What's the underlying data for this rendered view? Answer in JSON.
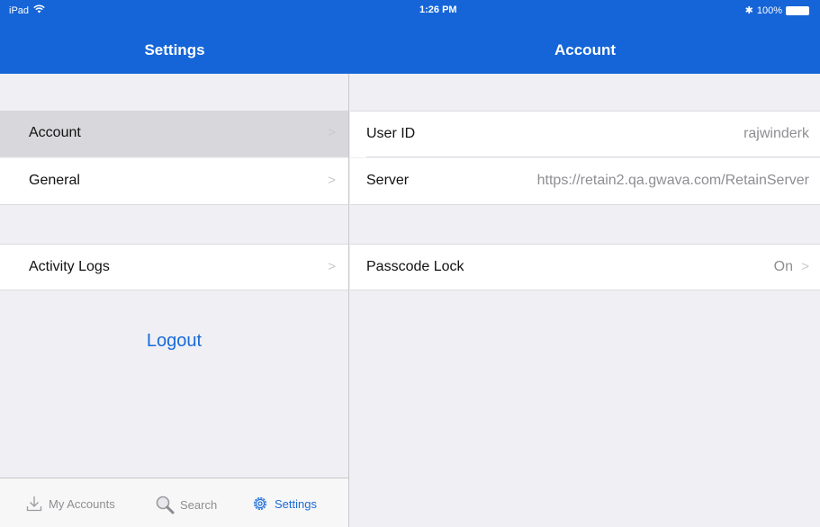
{
  "status_bar": {
    "device": "iPad",
    "time": "1:26 PM",
    "battery": "100%"
  },
  "master": {
    "title": "Settings",
    "items": [
      {
        "label": "Account",
        "selected": true
      },
      {
        "label": "General"
      },
      {
        "label": "Activity Logs"
      }
    ],
    "logout_label": "Logout"
  },
  "detail": {
    "title": "Account",
    "user_id_label": "User ID",
    "user_id_value": "rajwinderk",
    "server_label": "Server",
    "server_value": "https://retain2.qa.gwava.com/RetainServer",
    "passcode_label": "Passcode Lock",
    "passcode_value": "On"
  },
  "tab_bar": {
    "items": [
      {
        "label": "My Accounts",
        "icon": "download-icon"
      },
      {
        "label": "Search",
        "icon": "magnifier-icon"
      },
      {
        "label": "Settings",
        "icon": "gear-icon",
        "active": true
      }
    ]
  },
  "colors": {
    "header": "#1565d8",
    "accent": "#1a6ad8",
    "background": "#efeff4"
  }
}
